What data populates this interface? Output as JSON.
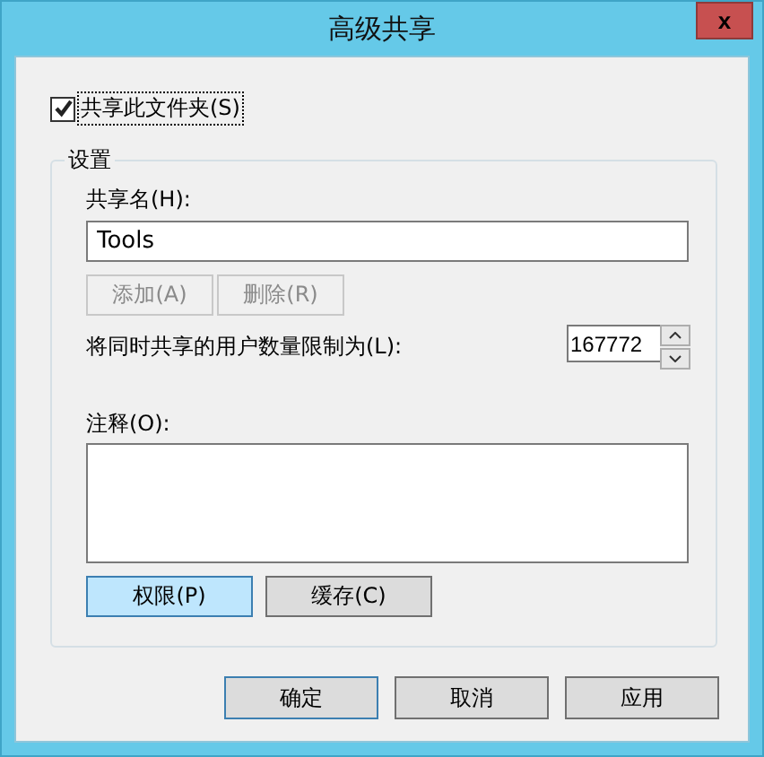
{
  "window": {
    "title": "高级共享",
    "close": "x"
  },
  "share_checkbox": {
    "label": "共享此文件夹(S)",
    "checked": true
  },
  "settings": {
    "legend": "设置",
    "share_name": {
      "label": "共享名(H):",
      "value": "Tools"
    },
    "name_buttons": [
      {
        "label": "添加(A)",
        "disabled": true
      },
      {
        "label": "删除(R)",
        "disabled": true
      }
    ],
    "user_limit": {
      "label": "将同时共享的用户数量限制为(L):",
      "value": "167772"
    },
    "comment": {
      "label": "注释(O):"
    },
    "buttons": [
      {
        "label": "权限(P)",
        "highlighted": true
      },
      {
        "label": "缓存(C)",
        "highlighted": false
      }
    ]
  },
  "footer_buttons": [
    {
      "label": "确定",
      "highlighted": true
    },
    {
      "label": "取消",
      "highlighted": false
    },
    {
      "label": "应用",
      "highlighted": false
    }
  ]
}
